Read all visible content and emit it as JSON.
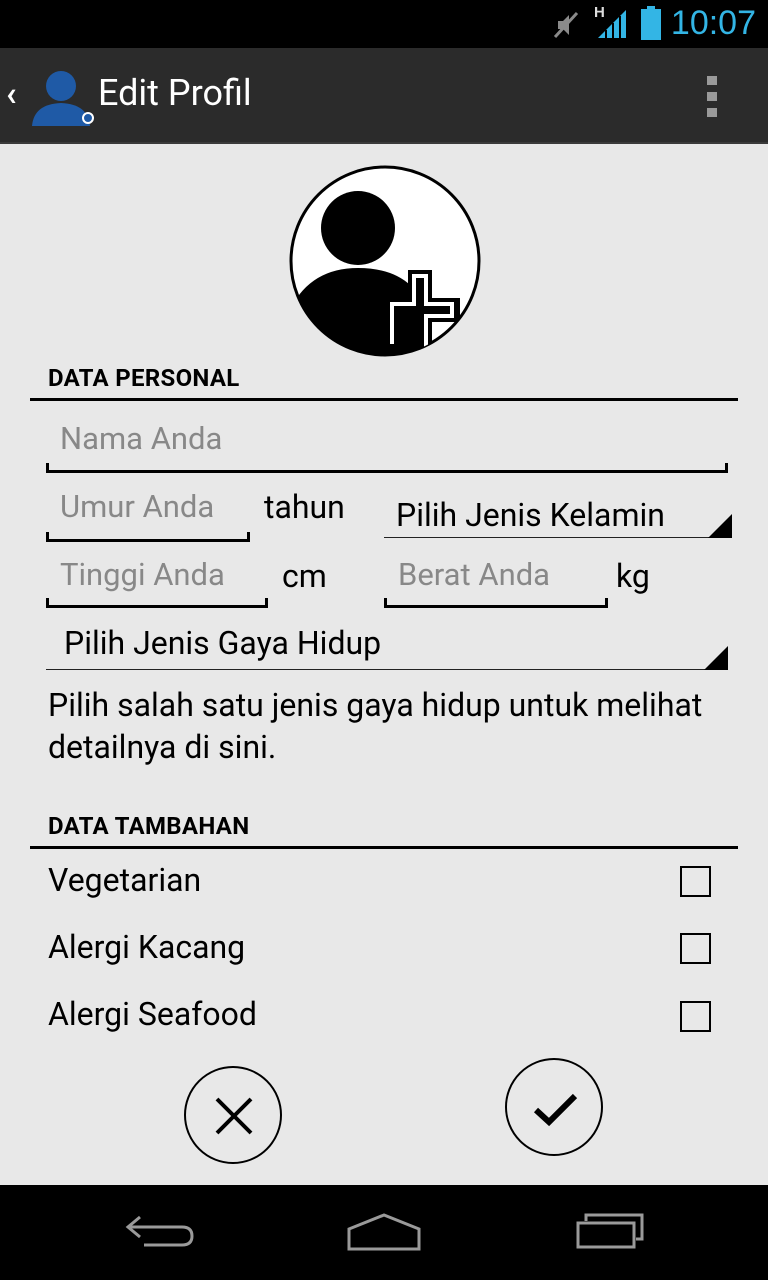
{
  "status_bar": {
    "time": "10:07",
    "network_type": "H",
    "icons": [
      "mute-icon",
      "signal-icon",
      "battery-icon"
    ]
  },
  "action_bar": {
    "title": "Edit Profil",
    "icons": [
      "up-caret-icon",
      "profile-icon",
      "overflow-menu-icon"
    ]
  },
  "avatar": {
    "icon": "add-user-photo-icon"
  },
  "personal": {
    "title": "DATA PERSONAL",
    "name_placeholder": "Nama Anda",
    "age_placeholder": "Umur Anda",
    "age_unit": "tahun",
    "gender_select": "Pilih Jenis Kelamin",
    "height_placeholder": "Tinggi Anda",
    "height_unit": "cm",
    "weight_placeholder": "Berat Anda",
    "weight_unit": "kg",
    "lifestyle_select": "Pilih Jenis Gaya Hidup",
    "lifestyle_hint": "Pilih salah satu jenis gaya hidup untuk melihat detailnya di sini."
  },
  "additional": {
    "title": "DATA TAMBAHAN",
    "items": [
      {
        "label": "Vegetarian",
        "checked": false
      },
      {
        "label": "Alergi Kacang",
        "checked": false
      },
      {
        "label": "Alergi Seafood",
        "checked": false
      }
    ]
  },
  "actions": {
    "cancel_icon": "close-icon",
    "confirm_icon": "check-icon"
  },
  "nav_bar": {
    "icons": [
      "back-icon",
      "home-icon",
      "recent-apps-icon"
    ]
  },
  "colors": {
    "accent": "#33b5e5",
    "action_bar": "#2b2b2b",
    "background": "#e8e8e8"
  }
}
